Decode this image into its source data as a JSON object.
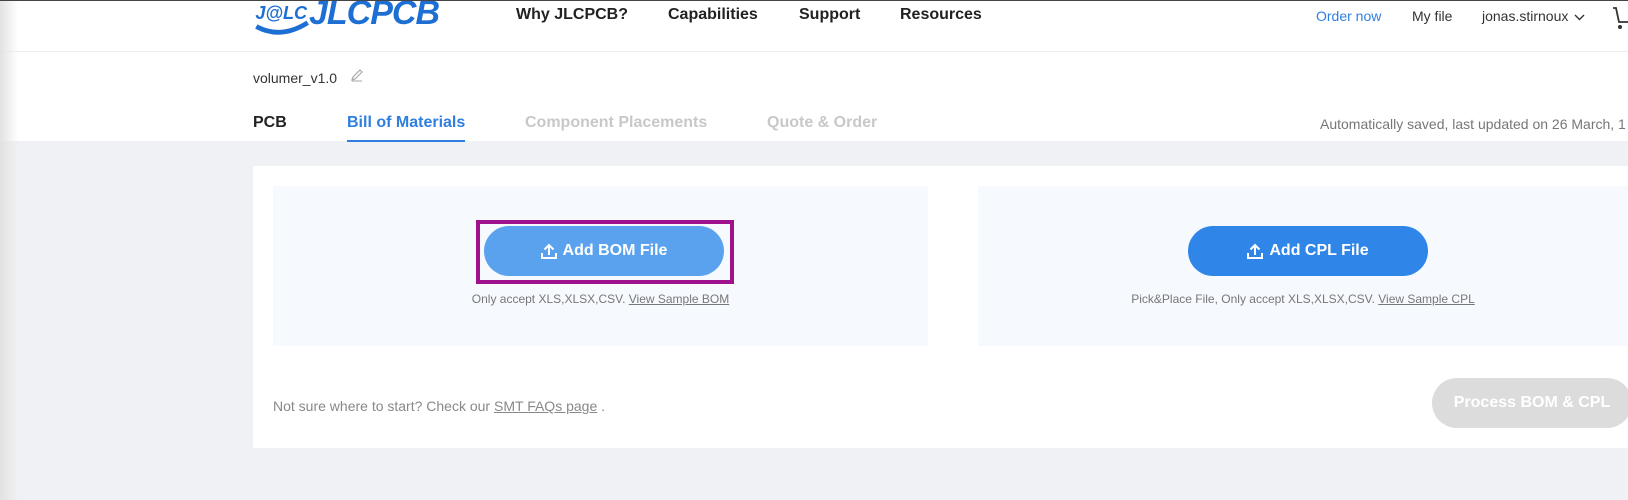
{
  "brand": {
    "badge": "J@LC",
    "name": "JLCPCB",
    "color": "#1e6fd4"
  },
  "nav": [
    "Why JLCPCB?",
    "Capabilities",
    "Support",
    "Resources"
  ],
  "header_right": {
    "order_now": "Order now",
    "my_file": "My file",
    "username": "jonas.stirnoux"
  },
  "project": {
    "name": "volumer_v1.0"
  },
  "tabs": [
    {
      "label": "PCB",
      "state": "done"
    },
    {
      "label": "Bill of Materials",
      "state": "active"
    },
    {
      "label": "Component Placements",
      "state": "disabled"
    },
    {
      "label": "Quote & Order",
      "state": "disabled"
    }
  ],
  "autosave_text": "Automatically saved, last updated on 26 March, 1",
  "bom_panel": {
    "button_label": "Add BOM File",
    "hint": "Only accept XLS,XLSX,CSV.",
    "sample_link": "View Sample BOM"
  },
  "cpl_panel": {
    "button_label": "Add CPL File",
    "hint": "Pick&Place File, Only accept XLS,XLSX,CSV.",
    "sample_link": "View Sample CPL"
  },
  "help": {
    "text": "Not sure where to start? Check our",
    "link": "SMT FAQs page",
    "suffix": "."
  },
  "process_button": "Process BOM & CPL",
  "colors": {
    "accent": "#2f7fe0",
    "highlight": "#a0128c",
    "disabled_button": "#dcdcdc"
  }
}
